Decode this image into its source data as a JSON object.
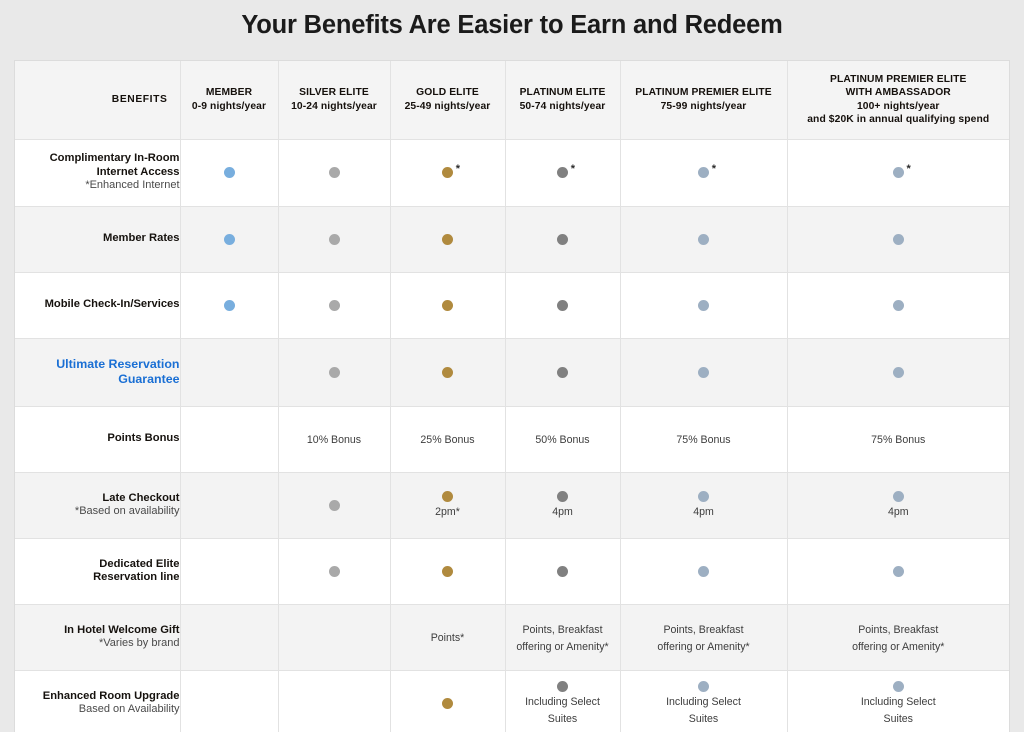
{
  "page": {
    "title": "Your Benefits Are Easier to Earn and Redeem",
    "background_color": "#e9e9e9"
  },
  "colors": {
    "member_dot": "#78aede",
    "silver_dot": "#a9a9a9",
    "gold_dot": "#b08a3e",
    "platinum_dot": "#808080",
    "platinum_premier_dot": "#9dafc2",
    "link_blue": "#1a6fd4",
    "row_alt": "#f3f3f3",
    "header_bg": "#f4f4f4"
  },
  "table": {
    "columns": [
      {
        "key": "benefit",
        "label": "BENEFITS",
        "sub": "",
        "sub2": "",
        "sub3": ""
      },
      {
        "key": "member",
        "label": "MEMBER",
        "sub": "0-9 nights/year",
        "sub2": "",
        "sub3": ""
      },
      {
        "key": "silver",
        "label": "SILVER ELITE",
        "sub": "10-24 nights/year",
        "sub2": "",
        "sub3": ""
      },
      {
        "key": "gold",
        "label": "GOLD ELITE",
        "sub": "25-49 nights/year",
        "sub2": "",
        "sub3": ""
      },
      {
        "key": "platinum",
        "label": "PLATINUM ELITE",
        "sub": "50-74 nights/year",
        "sub2": "",
        "sub3": ""
      },
      {
        "key": "platprem",
        "label": "PLATINUM PREMIER ELITE",
        "sub": "75-99 nights/year",
        "sub2": "",
        "sub3": ""
      },
      {
        "key": "ambassador",
        "label": "PLATINUM PREMIER ELITE",
        "sub": "WITH AMBASSADOR",
        "sub2": "100+ nights/year",
        "sub3": "and $20K in annual qualifying spend"
      }
    ],
    "rows": [
      {
        "name": "complimentary-in-room-internet-access",
        "label": "Complimentary In-Room",
        "label2": "Internet Access",
        "note": "*Enhanced Internet",
        "is_link": false,
        "cells": {
          "member": {
            "dot": "member",
            "star": false,
            "text": "",
            "text2": ""
          },
          "silver": {
            "dot": "silver",
            "star": false,
            "text": "",
            "text2": ""
          },
          "gold": {
            "dot": "gold",
            "star": true,
            "text": "",
            "text2": ""
          },
          "platinum": {
            "dot": "platinum",
            "star": true,
            "text": "",
            "text2": ""
          },
          "platprem": {
            "dot": "platprem",
            "star": true,
            "text": "",
            "text2": ""
          },
          "ambassador": {
            "dot": "platprem",
            "star": true,
            "text": "",
            "text2": ""
          }
        }
      },
      {
        "name": "member-rates",
        "label": "Member Rates",
        "label2": "",
        "note": "",
        "is_link": false,
        "cells": {
          "member": {
            "dot": "member",
            "star": false,
            "text": "",
            "text2": ""
          },
          "silver": {
            "dot": "silver",
            "star": false,
            "text": "",
            "text2": ""
          },
          "gold": {
            "dot": "gold",
            "star": false,
            "text": "",
            "text2": ""
          },
          "platinum": {
            "dot": "platinum",
            "star": false,
            "text": "",
            "text2": ""
          },
          "platprem": {
            "dot": "platprem",
            "star": false,
            "text": "",
            "text2": ""
          },
          "ambassador": {
            "dot": "platprem",
            "star": false,
            "text": "",
            "text2": ""
          }
        }
      },
      {
        "name": "mobile-check-in-services",
        "label": "Mobile Check-In/Services",
        "label2": "",
        "note": "",
        "is_link": false,
        "cells": {
          "member": {
            "dot": "member",
            "star": false,
            "text": "",
            "text2": ""
          },
          "silver": {
            "dot": "silver",
            "star": false,
            "text": "",
            "text2": ""
          },
          "gold": {
            "dot": "gold",
            "star": false,
            "text": "",
            "text2": ""
          },
          "platinum": {
            "dot": "platinum",
            "star": false,
            "text": "",
            "text2": ""
          },
          "platprem": {
            "dot": "platprem",
            "star": false,
            "text": "",
            "text2": ""
          },
          "ambassador": {
            "dot": "platprem",
            "star": false,
            "text": "",
            "text2": ""
          }
        }
      },
      {
        "name": "ultimate-reservation-guarantee",
        "label": "Ultimate Reservation",
        "label2": "Guarantee",
        "note": "",
        "is_link": true,
        "cells": {
          "member": {
            "dot": "",
            "star": false,
            "text": "",
            "text2": ""
          },
          "silver": {
            "dot": "silver",
            "star": false,
            "text": "",
            "text2": ""
          },
          "gold": {
            "dot": "gold",
            "star": false,
            "text": "",
            "text2": ""
          },
          "platinum": {
            "dot": "platinum",
            "star": false,
            "text": "",
            "text2": ""
          },
          "platprem": {
            "dot": "platprem",
            "star": false,
            "text": "",
            "text2": ""
          },
          "ambassador": {
            "dot": "platprem",
            "star": false,
            "text": "",
            "text2": ""
          }
        }
      },
      {
        "name": "points-bonus",
        "label": "Points Bonus",
        "label2": "",
        "note": "",
        "is_link": false,
        "cells": {
          "member": {
            "dot": "",
            "star": false,
            "text": "",
            "text2": ""
          },
          "silver": {
            "dot": "",
            "star": false,
            "text": "10% Bonus",
            "text2": ""
          },
          "gold": {
            "dot": "",
            "star": false,
            "text": "25% Bonus",
            "text2": ""
          },
          "platinum": {
            "dot": "",
            "star": false,
            "text": "50% Bonus",
            "text2": ""
          },
          "platprem": {
            "dot": "",
            "star": false,
            "text": "75% Bonus",
            "text2": ""
          },
          "ambassador": {
            "dot": "",
            "star": false,
            "text": "75% Bonus",
            "text2": ""
          }
        }
      },
      {
        "name": "late-checkout",
        "label": "Late Checkout",
        "label2": "",
        "note": "*Based on availability",
        "is_link": false,
        "cells": {
          "member": {
            "dot": "",
            "star": false,
            "text": "",
            "text2": ""
          },
          "silver": {
            "dot": "silver",
            "star": false,
            "text": "",
            "text2": ""
          },
          "gold": {
            "dot": "gold",
            "star": false,
            "text": "2pm*",
            "text2": ""
          },
          "platinum": {
            "dot": "platinum",
            "star": false,
            "text": "4pm",
            "text2": ""
          },
          "platprem": {
            "dot": "platprem",
            "star": false,
            "text": "4pm",
            "text2": ""
          },
          "ambassador": {
            "dot": "platprem",
            "star": false,
            "text": "4pm",
            "text2": ""
          }
        }
      },
      {
        "name": "dedicated-elite-reservation-line",
        "label": "Dedicated Elite",
        "label2": "Reservation line",
        "note": "",
        "is_link": false,
        "cells": {
          "member": {
            "dot": "",
            "star": false,
            "text": "",
            "text2": ""
          },
          "silver": {
            "dot": "silver",
            "star": false,
            "text": "",
            "text2": ""
          },
          "gold": {
            "dot": "gold",
            "star": false,
            "text": "",
            "text2": ""
          },
          "platinum": {
            "dot": "platinum",
            "star": false,
            "text": "",
            "text2": ""
          },
          "platprem": {
            "dot": "platprem",
            "star": false,
            "text": "",
            "text2": ""
          },
          "ambassador": {
            "dot": "platprem",
            "star": false,
            "text": "",
            "text2": ""
          }
        }
      },
      {
        "name": "in-hotel-welcome-gift",
        "label": "In Hotel Welcome Gift",
        "label2": "",
        "note": "*Varies by brand",
        "is_link": false,
        "cells": {
          "member": {
            "dot": "",
            "star": false,
            "text": "",
            "text2": ""
          },
          "silver": {
            "dot": "",
            "star": false,
            "text": "",
            "text2": ""
          },
          "gold": {
            "dot": "",
            "star": false,
            "text": "Points*",
            "text2": ""
          },
          "platinum": {
            "dot": "",
            "star": false,
            "text": "Points, Breakfast",
            "text2": "offering or Amenity*"
          },
          "platprem": {
            "dot": "",
            "star": false,
            "text": "Points, Breakfast",
            "text2": "offering or Amenity*"
          },
          "ambassador": {
            "dot": "",
            "star": false,
            "text": "Points, Breakfast",
            "text2": "offering or Amenity*"
          }
        }
      },
      {
        "name": "enhanced-room-upgrade",
        "label": "Enhanced Room Upgrade",
        "label2": "",
        "note": "Based on Availability",
        "is_link": false,
        "cells": {
          "member": {
            "dot": "",
            "star": false,
            "text": "",
            "text2": ""
          },
          "silver": {
            "dot": "",
            "star": false,
            "text": "",
            "text2": ""
          },
          "gold": {
            "dot": "gold",
            "star": false,
            "text": "",
            "text2": ""
          },
          "platinum": {
            "dot": "platinum",
            "star": false,
            "text": "Including Select",
            "text2": "Suites"
          },
          "platprem": {
            "dot": "platprem",
            "star": false,
            "text": "Including Select",
            "text2": "Suites"
          },
          "ambassador": {
            "dot": "platprem",
            "star": false,
            "text": "Including Select",
            "text2": "Suites"
          }
        }
      }
    ]
  }
}
